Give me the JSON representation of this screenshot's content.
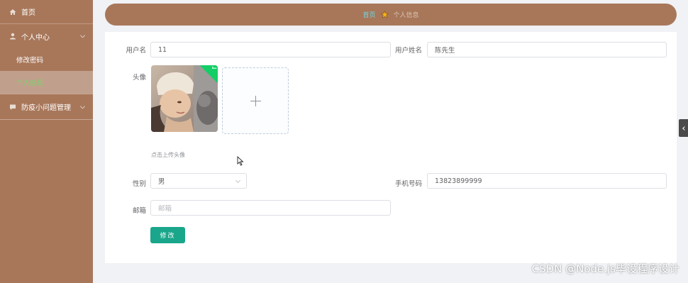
{
  "sidebar": {
    "home": "首页",
    "personal_center": "个人中心",
    "change_password": "修改密码",
    "personal_info": "个人信息",
    "epidemic_questions": "防疫小问题管理"
  },
  "breadcrumb": {
    "home": "首页",
    "current": "个人信息"
  },
  "form": {
    "username_label": "用户名",
    "username_value": "11",
    "realname_label": "用户姓名",
    "realname_value": "陈先生",
    "avatar_label": "头像",
    "upload_tip": "点击上传头像",
    "gender_label": "性别",
    "gender_value": "男",
    "phone_label": "手机号码",
    "phone_value": "13823899999",
    "email_label": "邮箱",
    "email_placeholder": "邮箱",
    "submit_label": "修改"
  },
  "watermark": "CSDN @Node.js毕设程序设计",
  "colors": {
    "sidebar_bg": "#a8775a",
    "active_text": "#7ad36a",
    "primary_button": "#1aa68a",
    "breadcrumb_home": "#6fd4e0",
    "upload_success": "#13ce66"
  },
  "icons": {
    "home": "home-icon",
    "user": "user-icon",
    "chat": "chat-icon",
    "star": "star-icon",
    "plus": "plus-icon",
    "check": "check-icon",
    "collapse": "chevron-left-icon"
  }
}
